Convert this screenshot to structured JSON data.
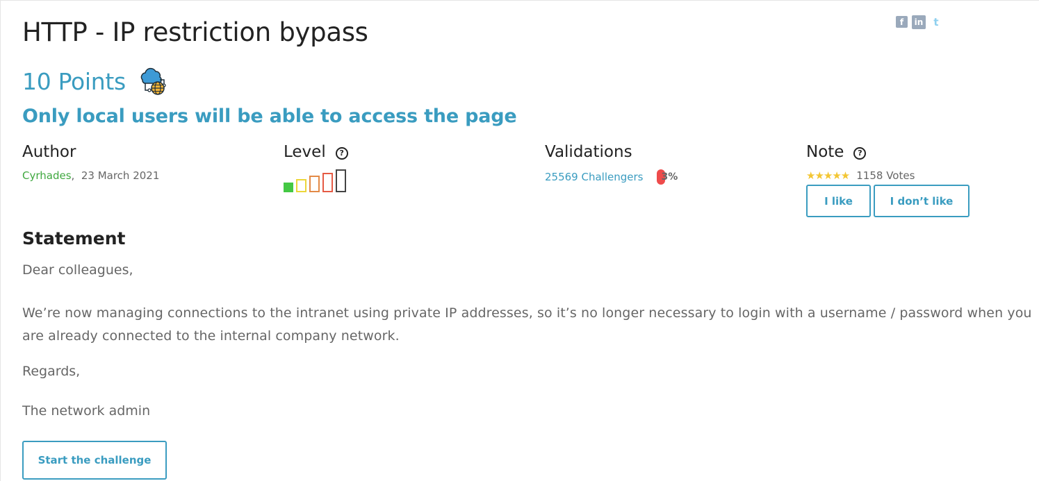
{
  "share": {
    "facebook": "f",
    "linkedin": "in",
    "twitter": "t"
  },
  "challenge": {
    "title": "HTTP - IP restriction bypass",
    "points": "10 Points",
    "subtitle": "Only local users will be able to access the page",
    "category_icon": "network-cloud-globe-icon"
  },
  "author": {
    "heading": "Author",
    "name": "Cyrhades",
    "separator": ",",
    "date": "23 March 2021"
  },
  "level": {
    "heading": "Level",
    "help": "?",
    "current": 1,
    "max": 5
  },
  "validations": {
    "heading": "Validations",
    "challengers": "25569 Challengers",
    "percent": "3%"
  },
  "note": {
    "heading": "Note",
    "help": "?",
    "stars": "★★★★★",
    "rating": 5,
    "votes": "1158 Votes",
    "like_label": "I like",
    "dislike_label": "I don’t like"
  },
  "statement": {
    "heading": "Statement",
    "greeting": "Dear colleagues,",
    "body": "We’re now managing connections to the intranet using private IP addresses, so it’s no longer necessary to login with a username / password when you are already connected to the internal company network.",
    "closing": "Regards,",
    "signature": "The network admin"
  },
  "start_label": "Start the challenge",
  "colors": {
    "accent": "#3a9cc0",
    "author": "#3fa83f",
    "star": "#f3c633",
    "percent_bar": "#ee4b4b"
  }
}
